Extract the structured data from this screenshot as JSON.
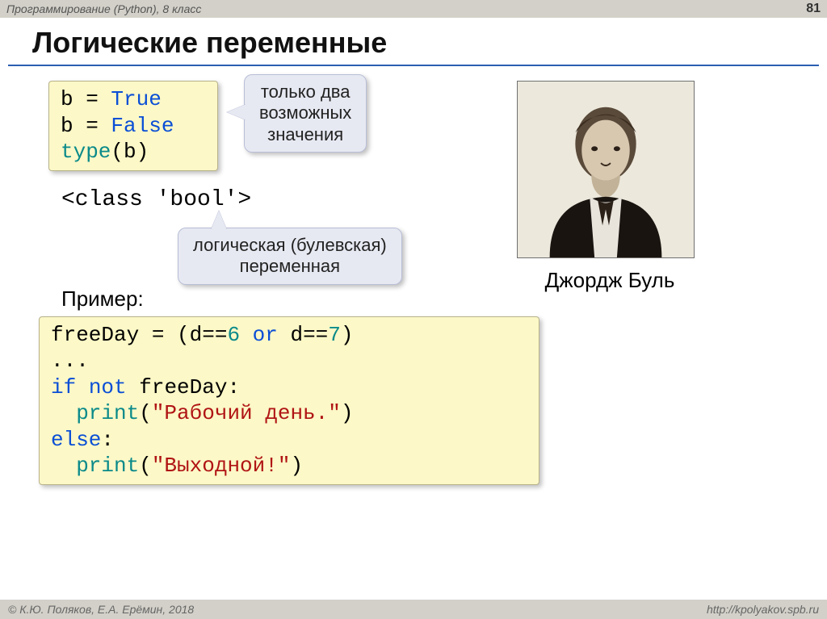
{
  "header": {
    "course": "Программирование (Python), 8 класс",
    "page": "81"
  },
  "title": "Логические переменные",
  "code1": {
    "l1a": "b = ",
    "l1b": "True",
    "l2a": "b = ",
    "l2b": "False",
    "l3a": "type",
    "l3b": "(b)"
  },
  "callout1": {
    "line1": "только два",
    "line2": "возможных",
    "line3": "значения"
  },
  "class_output": "<class 'bool'>",
  "callout2": {
    "line1": "логическая (булевская)",
    "line2": "переменная"
  },
  "portrait_caption": "Джордж Буль",
  "example_label": "Пример:",
  "code2": {
    "l1a": "freeDay = (d==",
    "l1b": "6",
    "l1c": " or",
    "l1d": " d==",
    "l1e": "7",
    "l1f": ")",
    "l2": "...",
    "l3a": "if",
    "l3b": " not",
    "l3c": " freeDay:",
    "l4a": "  print",
    "l4b": "(",
    "l4c": "\"Рабочий день.\"",
    "l4d": ")",
    "l5a": "else",
    "l5b": ":",
    "l6a": "  print",
    "l6b": "(",
    "l6c": "\"Выходной!\"",
    "l6d": ")"
  },
  "footer": {
    "copyright": "© К.Ю. Поляков, Е.А. Ерёмин, 2018",
    "url": "http://kpolyakov.spb.ru"
  }
}
